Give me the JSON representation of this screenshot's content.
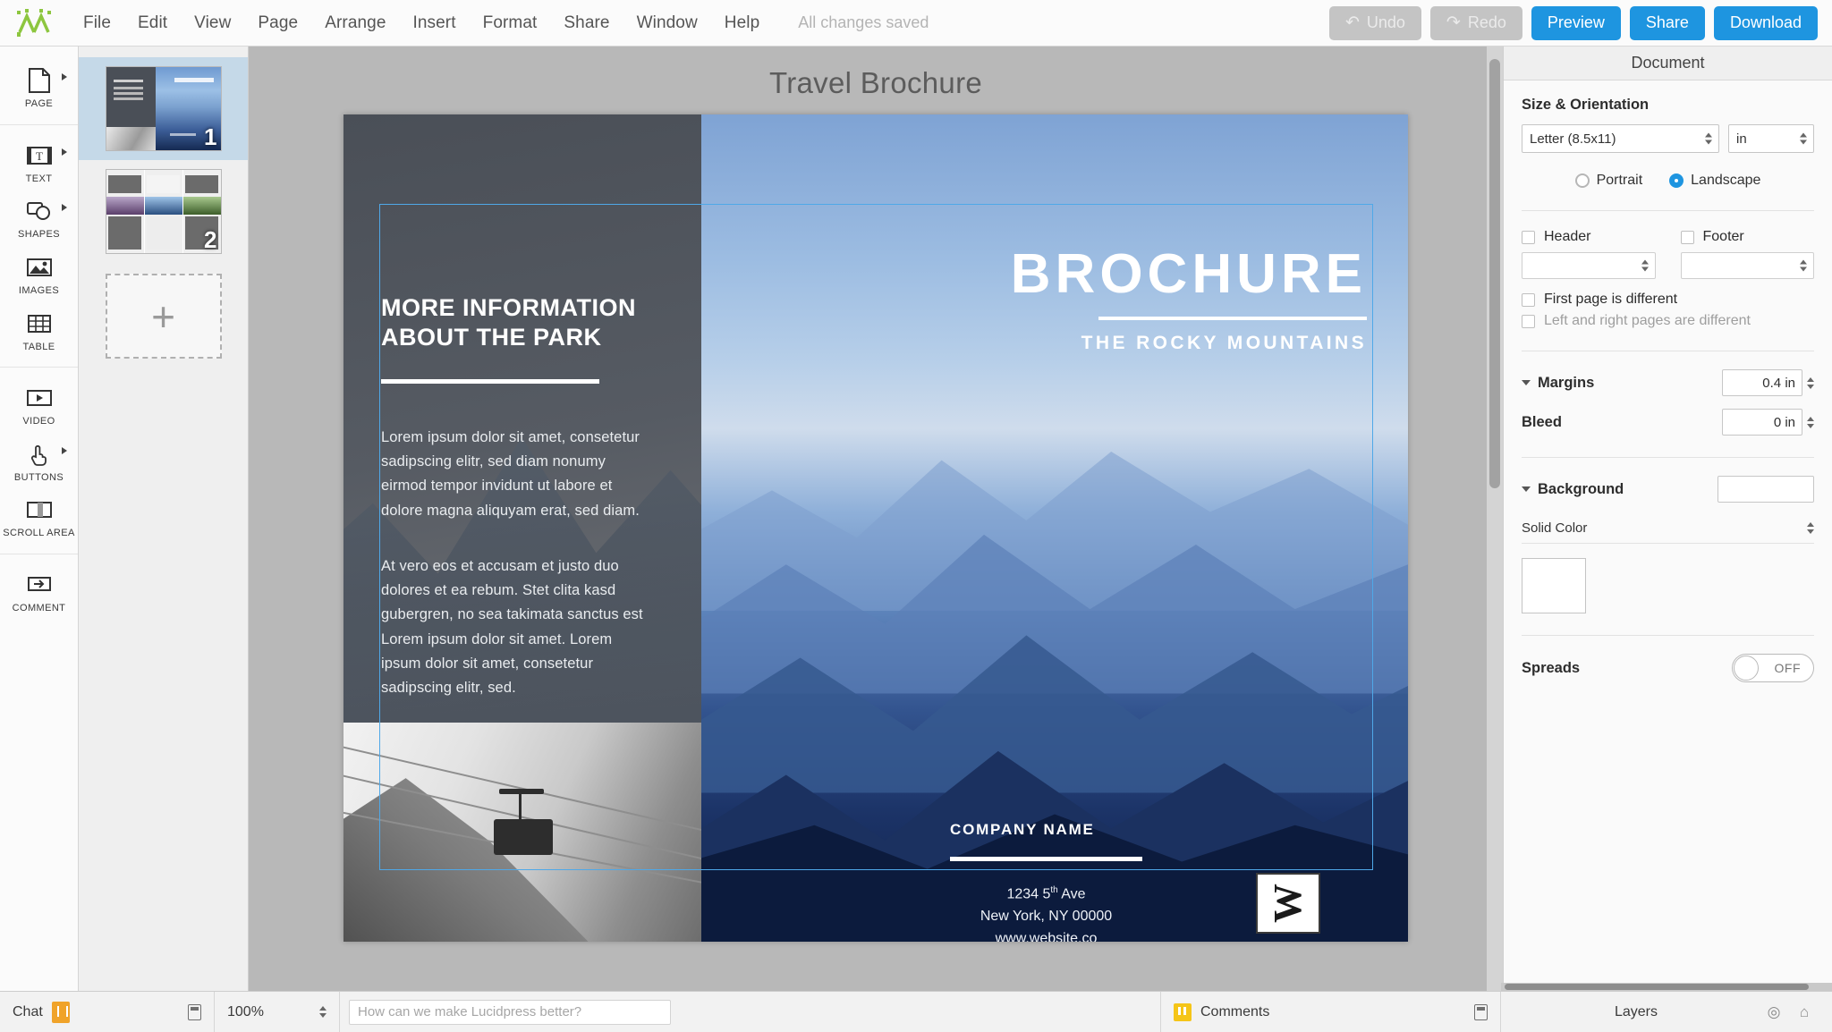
{
  "app": {
    "logo_icon": "lucidpress-logo-icon",
    "save_status": "All changes saved"
  },
  "menu": {
    "items": [
      {
        "label": "File"
      },
      {
        "label": "Edit"
      },
      {
        "label": "View"
      },
      {
        "label": "Page"
      },
      {
        "label": "Arrange"
      },
      {
        "label": "Insert"
      },
      {
        "label": "Format"
      },
      {
        "label": "Share"
      },
      {
        "label": "Window"
      },
      {
        "label": "Help"
      }
    ]
  },
  "toolbar_buttons": {
    "undo": {
      "label": "Undo",
      "icon": "undo-arrow-icon",
      "glyph": "↶",
      "state": "disabled"
    },
    "redo": {
      "label": "Redo",
      "icon": "redo-arrow-icon",
      "glyph": "↷",
      "state": "disabled"
    },
    "preview": {
      "label": "Preview"
    },
    "share": {
      "label": "Share"
    },
    "download": {
      "label": "Download"
    },
    "accent_color": "#1e95e0",
    "disabled_color": "#c4c4c4"
  },
  "left_tools": [
    {
      "label": "PAGE",
      "icon": "page-icon",
      "has_caret": true
    },
    {
      "label": "TEXT",
      "icon": "text-box-icon",
      "has_caret": true
    },
    {
      "label": "SHAPES",
      "icon": "shapes-icon",
      "has_caret": true
    },
    {
      "label": "IMAGES",
      "icon": "image-icon",
      "has_caret": false
    },
    {
      "label": "TABLE",
      "icon": "table-grid-icon",
      "has_caret": false
    },
    {
      "label": "VIDEO",
      "icon": "video-play-icon",
      "has_caret": false
    },
    {
      "label": "BUTTONS",
      "icon": "pointer-hand-icon",
      "has_caret": true
    },
    {
      "label": "SCROLL AREA",
      "icon": "scroll-area-icon",
      "has_caret": false
    },
    {
      "label": "COMMENT",
      "icon": "comment-icon",
      "has_caret": false
    }
  ],
  "pages_panel": {
    "pages": [
      {
        "number": "1",
        "selected": true
      },
      {
        "number": "2",
        "selected": false
      }
    ],
    "add_page_glyph": "+"
  },
  "canvas": {
    "document_title": "Travel Brochure"
  },
  "brochure": {
    "left_panel": {
      "heading_line1": "MORE INFORMATION",
      "heading_line2": "ABOUT THE PARK",
      "paragraph1": "Lorem ipsum dolor sit amet, consetetur sadipscing elitr, sed diam nonumy eirmod tempor invidunt ut labore et dolore magna aliquyam erat, sed diam.",
      "paragraph2": "At vero eos et accusam et justo duo dolores et ea rebum. Stet clita kasd gubergren, no sea takimata sanctus est Lorem ipsum dolor sit amet. Lorem ipsum dolor sit amet, consetetur sadipscing elitr, sed."
    },
    "cover": {
      "title": "BROCHURE",
      "subtitle": "THE ROCKY MOUNTAINS",
      "company_name": "COMPANY NAME",
      "address_line1": "1234 5",
      "address_line1_sup": "th",
      "address_line1_rest": " Ave",
      "address_line2": "New York, NY 00000",
      "address_line3": "www.website.co",
      "logo_mark": "W"
    }
  },
  "right_panel": {
    "title": "Document",
    "size_orientation": {
      "heading": "Size & Orientation",
      "page_size": "Letter (8.5x11)",
      "units": "in",
      "portrait_label": "Portrait",
      "landscape_label": "Landscape",
      "selected_orientation": "Landscape"
    },
    "header_footer": {
      "header_label": "Header",
      "footer_label": "Footer",
      "header_checked": false,
      "footer_checked": false,
      "first_page_different_label": "First page is different",
      "left_right_different_label": "Left and right pages are different",
      "first_page_different_checked": false,
      "left_right_different_checked": false
    },
    "margins": {
      "margins_label": "Margins",
      "margins_value": "0.4 in",
      "bleed_label": "Bleed",
      "bleed_value": "0 in"
    },
    "background": {
      "label": "Background",
      "fill_type": "Solid Color",
      "swatch_color": "#ffffff"
    },
    "spreads": {
      "label": "Spreads",
      "state": "OFF"
    }
  },
  "bottom_bar": {
    "chat_label": "Chat",
    "chat_badge_icon": "chat-badge-icon",
    "chat_panel_icon": "panel-toggle-icon",
    "zoom_level": "100%",
    "feedback_placeholder": "How can we make Lucidpress better?",
    "comments_label": "Comments",
    "comments_icon": "comments-icon",
    "comments_panel_icon": "panel-toggle-icon",
    "layers_label": "Layers",
    "layers_visibility_icon": "eye-icon",
    "layers_lock_icon": "lock-icon",
    "layers_visibility_glyph": "◎",
    "layers_lock_glyph": "⌂"
  }
}
